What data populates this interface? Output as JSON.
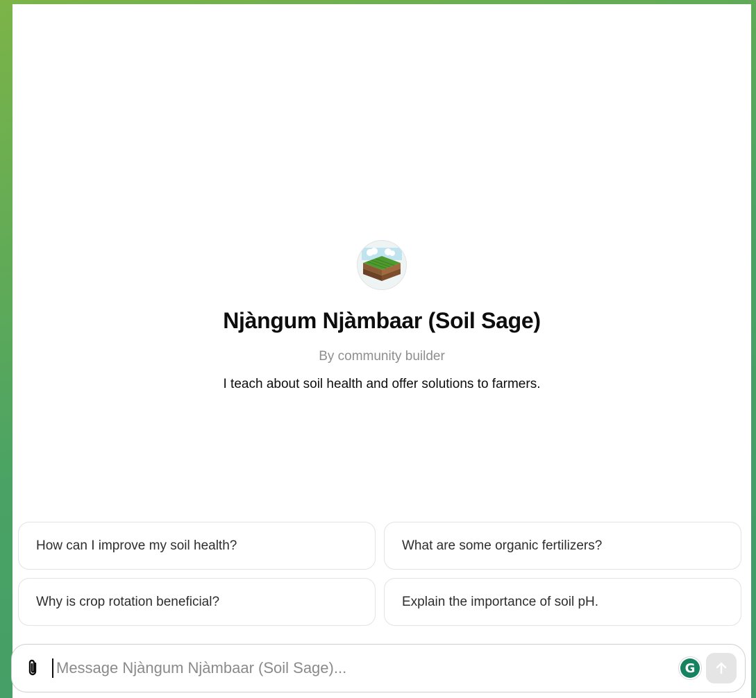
{
  "gpt": {
    "name": "Njàngum Njàmbaar (Soil Sage)",
    "byline": "By community builder",
    "description": "I teach about soil health and offer solutions to farmers.",
    "avatar_icon": "soil-layers-icon"
  },
  "starters": [
    {
      "label": "How can I improve my soil health?"
    },
    {
      "label": "What are some organic fertilizers?"
    },
    {
      "label": "Why is crop rotation beneficial?"
    },
    {
      "label": "Explain the importance of soil pH."
    }
  ],
  "composer": {
    "placeholder": "Message Njàngum Njàmbaar (Soil Sage)...",
    "value": "",
    "attach_icon": "paperclip-icon",
    "send_icon": "arrow-up-icon",
    "grammarly_letter": "G"
  },
  "colors": {
    "background_gradient_start": "#7cb447",
    "background_gradient_end": "#3f9a6a",
    "grammarly": "#15835f",
    "send_disabled": "#e5e5e5"
  }
}
